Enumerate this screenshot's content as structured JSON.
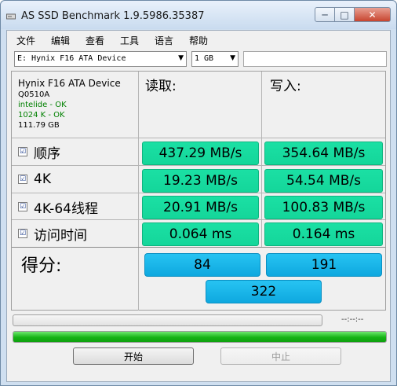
{
  "window": {
    "title": "AS SSD Benchmark 1.9.5986.35387",
    "min_label": "─",
    "max_label": "□",
    "close_label": "✕"
  },
  "menu": [
    "文件",
    "编辑",
    "查看",
    "工具",
    "语言",
    "帮助"
  ],
  "toolbar": {
    "drive_value": "E: Hynix F16 ATA Device",
    "size_value": "1 GB",
    "dropdown_arrow": "▼"
  },
  "device": {
    "name": "Hynix F16 ATA Device",
    "firmware": "Q0510A",
    "driver_status": "intelide - OK",
    "alignment_status": "1024 K - OK",
    "capacity": "111.79 GB"
  },
  "columns": {
    "read": "读取:",
    "write": "写入:"
  },
  "rows": [
    {
      "label": "顺序",
      "checked": "☑",
      "read": "437.29 MB/s",
      "write": "354.64 MB/s"
    },
    {
      "label": "4K",
      "checked": "☑",
      "read": "19.23 MB/s",
      "write": "54.54 MB/s"
    },
    {
      "label": "4K-64线程",
      "checked": "☑",
      "read": "20.91 MB/s",
      "write": "100.83 MB/s"
    },
    {
      "label": "访问时间",
      "checked": "☑",
      "read": "0.064 ms",
      "write": "0.164 ms"
    }
  ],
  "score": {
    "label": "得分:",
    "read": "84",
    "write": "191",
    "total": "322"
  },
  "progress": {
    "time": "--:--:--",
    "top_fraction": 0,
    "bottom_fraction": 1
  },
  "buttons": {
    "start": "开始",
    "stop": "中止"
  },
  "colors": {
    "result_green": "#1be0a4",
    "score_blue": "#27c3f2",
    "progress_green": "#15b315"
  }
}
